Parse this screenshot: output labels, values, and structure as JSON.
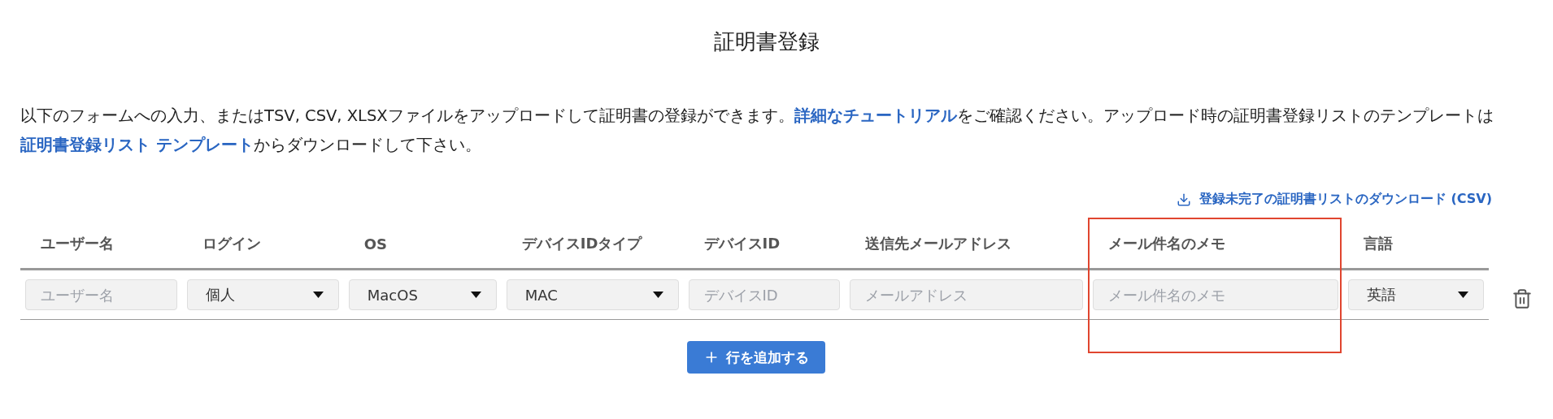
{
  "title": "証明書登録",
  "intro": "以下のフォームへの入力、またはTSV, CSV, XLSXファイルをアップロードして証明書の登録ができます。",
  "tutorial_link": "詳細なチュートリアル",
  "intro_2": "をご確認ください。アップロード時の証明書登録リストのテンプレートは",
  "template_link": "証明書登録リスト テンプレート",
  "intro_3": "からダウンロードして下さい。",
  "download_link": "登録未完了の証明書リストのダウンロード (CSV)",
  "table": {
    "columns": [
      {
        "label": "ユーザー名",
        "highlighted": false
      },
      {
        "label": "ログイン",
        "highlighted": false
      },
      {
        "label": "OS",
        "highlighted": false
      },
      {
        "label": "デバイスIDタイプ",
        "highlighted": false
      },
      {
        "label": "デバイスID",
        "highlighted": false
      },
      {
        "label": "送信先メールアドレス",
        "highlighted": false
      },
      {
        "label": "メール件名のメモ",
        "highlighted": true
      },
      {
        "label": "言語",
        "highlighted": false
      }
    ],
    "rows": [
      {
        "cells": [
          {
            "kind": "input",
            "placeholder": "ユーザー名"
          },
          {
            "kind": "select",
            "value": "個人"
          },
          {
            "kind": "select",
            "value": "MacOS"
          },
          {
            "kind": "select",
            "value": "MAC"
          },
          {
            "kind": "input",
            "placeholder": "デバイスID"
          },
          {
            "kind": "input",
            "placeholder": "メールアドレス"
          },
          {
            "kind": "input",
            "placeholder": "メール件名のメモ"
          },
          {
            "kind": "select",
            "value": "英語"
          }
        ]
      }
    ]
  },
  "add_row_button": "行を追加する"
}
